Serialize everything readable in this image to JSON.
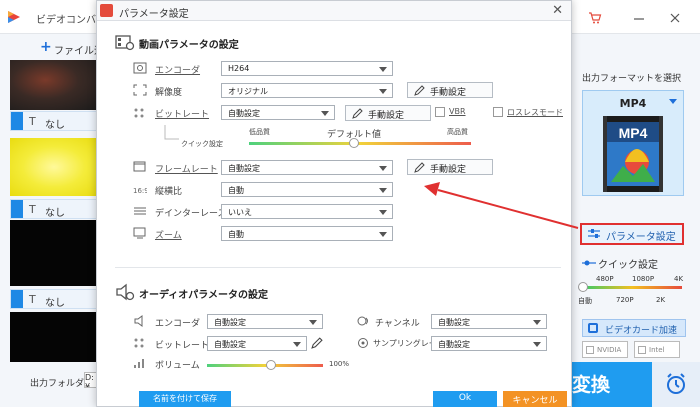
{
  "app": {
    "title": "ビデオコンバー",
    "add_file": "ファイル追",
    "subtitles": [
      "なし",
      "なし",
      "なし",
      "なし"
    ],
    "subtitle_icon": "T",
    "output_folder_label": "出力フォルダ：",
    "output_folder_value": "D:¥",
    "format_select_label": "出力フォーマットを選択",
    "format_name": "MP4",
    "param_button": "パラメータ設定",
    "quick_settings": "クイック設定",
    "quick_ticks_top": [
      "480P",
      "1080P",
      "4K"
    ],
    "quick_ticks_bottom": [
      "自動",
      "720P",
      "2K"
    ],
    "gpu_accel": "ビデオカード加速",
    "nvidia": "NVIDIA",
    "intel": "Intel",
    "convert": "変換",
    "icons": [
      "app-logo-icon",
      "cart-icon",
      "minimize-icon",
      "close-icon",
      "alarm-clock-icon",
      "sliders-icon",
      "mp4-format-icon"
    ]
  },
  "dialog": {
    "title": "パラメータ設定",
    "close": "✕",
    "video_section_title": "動画パラメータの設定",
    "video": {
      "encoder_label": "エンコーダ",
      "encoder_value": "H264",
      "resolution_label": "解像度",
      "resolution_value": "オリジナル",
      "bitrate_label": "ビットレート",
      "bitrate_value": "自動設定",
      "vbr_label": "VBR",
      "lossless_label": "ロスレスモード",
      "quick_setting_label": "クイック設定",
      "quality_low": "低品質",
      "quality_default": "デフォルト値",
      "quality_high": "高品質",
      "framerate_label": "フレームレート",
      "framerate_value": "自動設定",
      "aspect_label": "縦横比",
      "aspect_value": "自動",
      "deinterlace_label": "デインターレース",
      "deinterlace_value": "いいえ",
      "zoom_label": "ズーム",
      "zoom_value": "自動",
      "manual_button": "手動設定"
    },
    "audio_section_title": "オーディオパラメータの設定",
    "audio": {
      "encoder_label": "エンコーダ",
      "encoder_value": "自動設定",
      "channel_label": "チャンネル",
      "channel_value": "自動設定",
      "bitrate_label": "ビットレート",
      "bitrate_value": "自動設定",
      "samplerate_label": "サンプリングレート",
      "samplerate_value": "自動設定",
      "volume_label": "ボリューム",
      "volume_value": "100%",
      "volume_level": 0.55
    },
    "save_as_button": "名前を付けて保存",
    "ok_button": "Ok",
    "cancel_button": "キャンセル"
  },
  "colors": {
    "accent_blue": "#1f9cf0",
    "cancel_orange": "#f39224",
    "highlight_red": "#e03030"
  }
}
